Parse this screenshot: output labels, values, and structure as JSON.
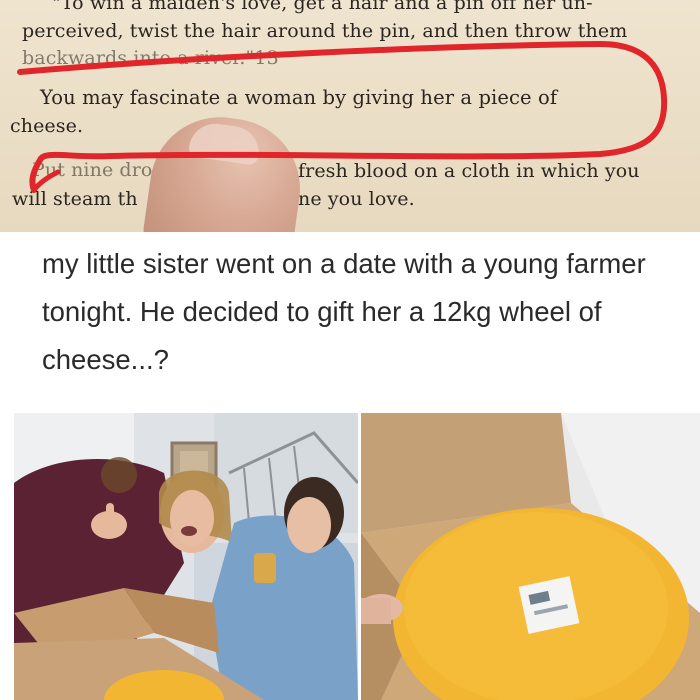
{
  "book": {
    "lines": [
      "\"To win a maiden's love, get a hair and a pin off her un-",
      "perceived, twist the hair around the pin, and then throw them",
      "backwards into a river.\"13",
      "You may fascinate a woman by giving her a piece of",
      "cheese.",
      "Put nine dro",
      "fresh blood on a cloth in which you",
      "will steam th",
      "ne you love."
    ]
  },
  "post": {
    "caption": "my little sister went on a date with a young farmer tonight. He decided to gift her a 12kg wheel of cheese...?"
  },
  "colors": {
    "highlight": "#e0262b",
    "cheese": "#f2b632",
    "box": "#c9a27a"
  }
}
